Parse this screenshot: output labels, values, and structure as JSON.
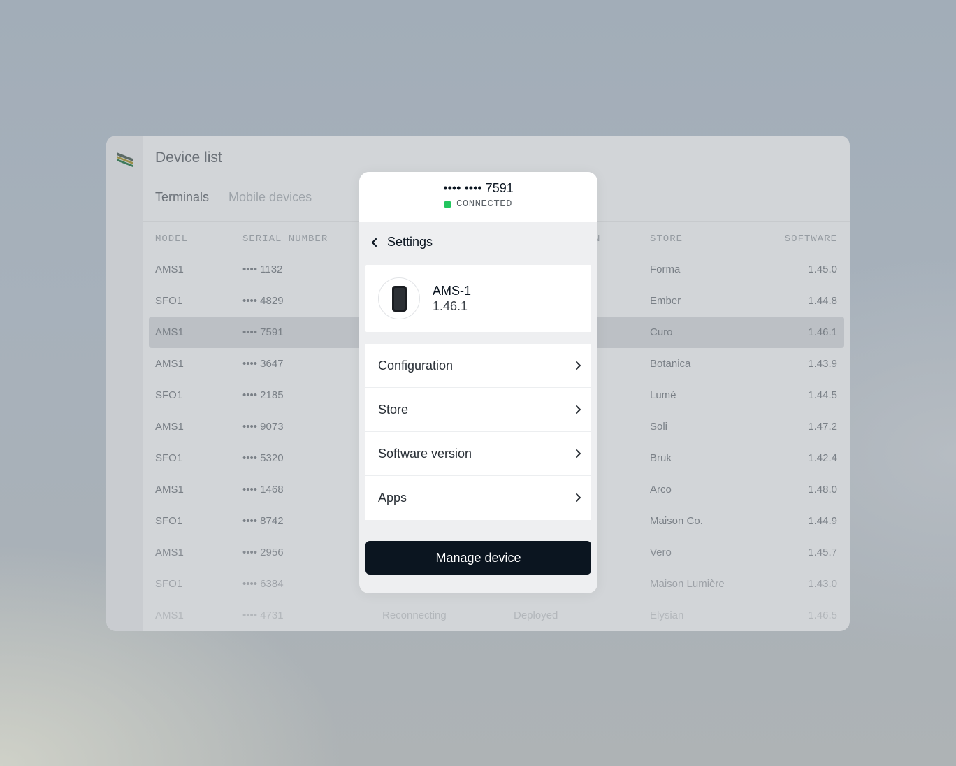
{
  "window": {
    "title": "Device list",
    "tabs": [
      {
        "label": "Terminals",
        "active": true
      },
      {
        "label": "Mobile devices",
        "active": false
      }
    ]
  },
  "table": {
    "headers": {
      "model": "MODEL",
      "serial": "SERIAL NUMBER",
      "dep": "N",
      "store": "STORE",
      "software": "SOFTWARE"
    },
    "rows": [
      {
        "model": "AMS1",
        "serial": "•••• 1132",
        "status": "",
        "dep": "",
        "store": "Forma",
        "software": "1.45.0"
      },
      {
        "model": "SFO1",
        "serial": "•••• 4829",
        "status": "",
        "dep": "",
        "store": "Ember",
        "software": "1.44.8"
      },
      {
        "model": "AMS1",
        "serial": "•••• 7591",
        "status": "",
        "dep": "",
        "store": "Curo",
        "software": "1.46.1"
      },
      {
        "model": "AMS1",
        "serial": "•••• 3647",
        "status": "",
        "dep": "",
        "store": "Botanica",
        "software": "1.43.9"
      },
      {
        "model": "SFO1",
        "serial": "•••• 2185",
        "status": "",
        "dep": "",
        "store": "Lumé",
        "software": "1.44.5"
      },
      {
        "model": "AMS1",
        "serial": "•••• 9073",
        "status": "",
        "dep": "",
        "store": "Soli",
        "software": "1.47.2"
      },
      {
        "model": "SFO1",
        "serial": "•••• 5320",
        "status": "",
        "dep": "",
        "store": "Bruk",
        "software": "1.42.4"
      },
      {
        "model": "AMS1",
        "serial": "•••• 1468",
        "status": "",
        "dep": "",
        "store": "Arco",
        "software": "1.48.0"
      },
      {
        "model": "SFO1",
        "serial": "•••• 8742",
        "status": "",
        "dep": "",
        "store": "Maison Co.",
        "software": "1.44.9"
      },
      {
        "model": "AMS1",
        "serial": "•••• 2956",
        "status": "",
        "dep": "",
        "store": "Vero",
        "software": "1.45.7"
      },
      {
        "model": "SFO1",
        "serial": "•••• 6384",
        "status": "",
        "dep": "",
        "store": "Maison Lumière",
        "software": "1.43.0"
      },
      {
        "model": "AMS1",
        "serial": "•••• 4731",
        "status": "Reconnecting",
        "dep": "Deployed",
        "store": "Elysian",
        "software": "1.46.5"
      }
    ],
    "selected_index": 2
  },
  "modal": {
    "serial": "•••• •••• 7591",
    "connection_status": "CONNECTED",
    "status_color": "#22c55e",
    "settings_label": "Settings",
    "device": {
      "name": "AMS-1",
      "version": "1.46.1",
      "icon": "terminal-device-icon"
    },
    "menu": [
      {
        "label": "Configuration"
      },
      {
        "label": "Store"
      },
      {
        "label": "Software version"
      },
      {
        "label": "Apps"
      }
    ],
    "primary_button": "Manage device"
  }
}
